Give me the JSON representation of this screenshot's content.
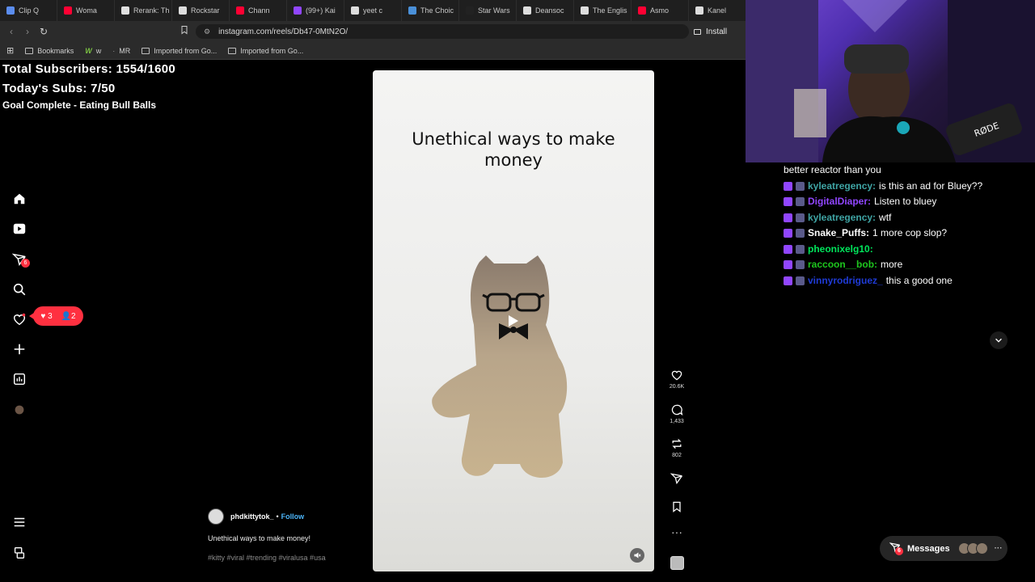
{
  "browser": {
    "tabs": [
      {
        "label": "Clip Q",
        "color": "#5b8dee"
      },
      {
        "label": "Woma",
        "color": "#ff0033"
      },
      {
        "label": "Rerank: Th",
        "color": "#e0e0e0"
      },
      {
        "label": "Rockstar",
        "color": "#dddddd"
      },
      {
        "label": "Chann",
        "color": "#ff0033"
      },
      {
        "label": "(99+) Kai",
        "color": "#9146ff"
      },
      {
        "label": "yeet c",
        "color": "#dddddd"
      },
      {
        "label": "The Choic",
        "color": "#4a90d9"
      },
      {
        "label": "Star Wars",
        "color": "#222222"
      },
      {
        "label": "Deansoc",
        "color": "#dddddd"
      },
      {
        "label": "The Englis",
        "color": "#dddddd"
      },
      {
        "label": "Asmo",
        "color": "#ff0033"
      },
      {
        "label": "Kanel",
        "color": "#dddddd"
      }
    ],
    "url": "instagram.com/reels/Db47-0MtN2O/",
    "install_label": "Install",
    "bookmarks": {
      "bookmarks_label": "Bookmarks",
      "w_label": "w",
      "mr_label": "MR",
      "folder1": "Imported from Go...",
      "folder2": "Imported from Go..."
    }
  },
  "stream_overlay": {
    "total_subs": "Total Subscribers: 1554/1600",
    "todays_subs": "Today's Subs: 7/50",
    "goal": "Goal Complete - Eating Bull Balls"
  },
  "instagram": {
    "nav_badge": "6",
    "notifications": {
      "likes": "3",
      "follows": "2"
    },
    "reel": {
      "title_line1": "Unethical ways to make",
      "title_line2": "money",
      "author": "phdkittytok_",
      "follow_label": "Follow",
      "separator": "•",
      "caption": "Unethical ways to make money!",
      "tags": "#kitty #viral #trending #viralusa #usa"
    },
    "actions": {
      "likes": "20.6K",
      "comments": "1,433",
      "reposts": "802"
    },
    "messages_label": "Messages",
    "messages_badge": "6"
  },
  "chat": {
    "partial_top": "better reactor than you",
    "messages": [
      {
        "user": "kyleatregency:",
        "text": "is this an ad for Bluey??",
        "color": "#3fa5a5"
      },
      {
        "user": "DigitalDiaper:",
        "text": "Listen to bluey",
        "color": "#9146ff"
      },
      {
        "user": "kyleatregency:",
        "text": "wtf",
        "color": "#3fa5a5"
      },
      {
        "user": "Snake_Puffs:",
        "text": "1 more cop slop?",
        "color": "#ffffff"
      },
      {
        "user": "pheonixelg10:",
        "text": "",
        "color": "#00e65c"
      },
      {
        "user": "raccoon__bob:",
        "text": "more",
        "color": "#1ec71e"
      },
      {
        "user": "vinnyrodriguez_",
        "text": "this a good one",
        "color": "#1f3bd6"
      }
    ]
  },
  "icons": [
    "home-icon",
    "reels-icon",
    "messages-icon",
    "search-icon",
    "heart-icon",
    "create-icon",
    "dashboard-icon",
    "profile-icon",
    "menu-icon",
    "more-icon"
  ]
}
